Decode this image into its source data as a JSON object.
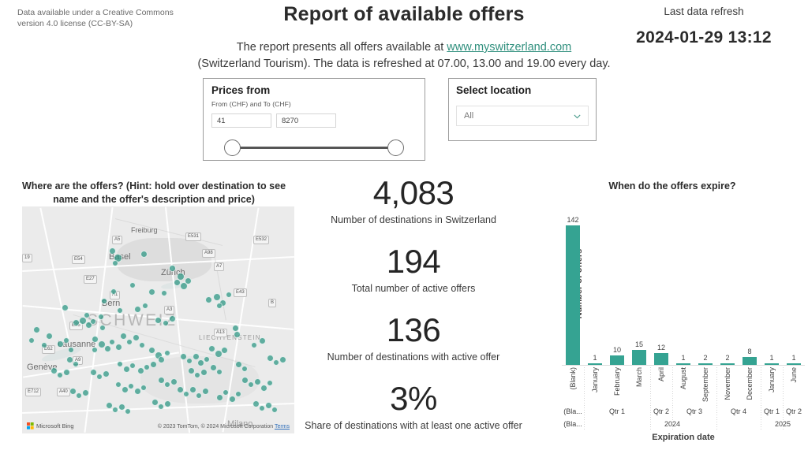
{
  "header": {
    "license": "Data available under a Creative Commons version 4.0 license (CC-BY-SA)",
    "title": "Report of available offers",
    "subtitle_line1_pre": "The report presents all offers available at ",
    "subtitle_link": "www.myswitzerland.com",
    "subtitle_line2": "(Switzerland Tourism). The data is refreshed at 07.00, 13.00 and 19.00 every day.",
    "refresh_label": "Last data refresh",
    "refresh_value": "2024-01-29 13:12"
  },
  "price_slicer": {
    "title": "Prices from",
    "subtitle": "From (CHF) and To (CHF)",
    "min_value": "41",
    "max_value": "8270"
  },
  "location_slicer": {
    "title": "Select location",
    "selected": "All",
    "chevron_icon": "chevron-down-icon"
  },
  "map": {
    "title": "Where are the offers? (Hint: hold over destination to see name and the offer's description and price)",
    "country_label": "SCHWEIZ",
    "provider_logo": "Microsoft Bing",
    "attribution": "© 2023 TomTom, © 2024 Microsoft Corporation",
    "terms_link": "Terms",
    "cities": [
      "Freiburg",
      "Basel",
      "Zürich",
      "Bern",
      "Lausanne",
      "Genève",
      "Milano"
    ],
    "country_labels": [
      "LIECHTENSTEIN"
    ],
    "road_shields": [
      "A5",
      "E531",
      "E532",
      "E54",
      "19",
      "A98",
      "A7",
      "E27",
      "A1",
      "E43",
      "A3",
      "B",
      "E25",
      "A13",
      "E62",
      "A9",
      "E712",
      "A40"
    ],
    "dot_color": "#2a9682"
  },
  "kpis": [
    {
      "value": "4,083",
      "label": "Number of destinations in Switzerland"
    },
    {
      "value": "194",
      "label": "Total number of active offers"
    },
    {
      "value": "136",
      "label": "Number of destinations with active offer"
    },
    {
      "value": "3%",
      "label": "Share of destinations with at least one active offer"
    }
  ],
  "chart_data": {
    "type": "bar",
    "title": "When do the offers expire?",
    "xlabel": "Expiration date",
    "ylabel": "Number of offers",
    "ylim": [
      0,
      150
    ],
    "grid": false,
    "legend": null,
    "bar_color": "#35a392",
    "categories": [
      "(Blank)",
      "January",
      "February",
      "March",
      "April",
      "August",
      "September",
      "November",
      "December",
      "January",
      "June"
    ],
    "values": [
      142,
      1,
      10,
      15,
      12,
      1,
      2,
      2,
      8,
      1,
      1
    ],
    "quarters": [
      {
        "label": "(Bla...",
        "span": 1
      },
      {
        "label": "Qtr 1",
        "span": 3
      },
      {
        "label": "Qtr 2",
        "span": 1
      },
      {
        "label": "Qtr 3",
        "span": 2
      },
      {
        "label": "Qtr 4",
        "span": 2
      },
      {
        "label": "Qtr 1",
        "span": 1
      },
      {
        "label": "Qtr 2",
        "span": 1
      }
    ],
    "years": [
      {
        "label": "(Bla...",
        "span": 1
      },
      {
        "label": "2024",
        "span": 8
      },
      {
        "label": "2025",
        "span": 2
      }
    ]
  }
}
